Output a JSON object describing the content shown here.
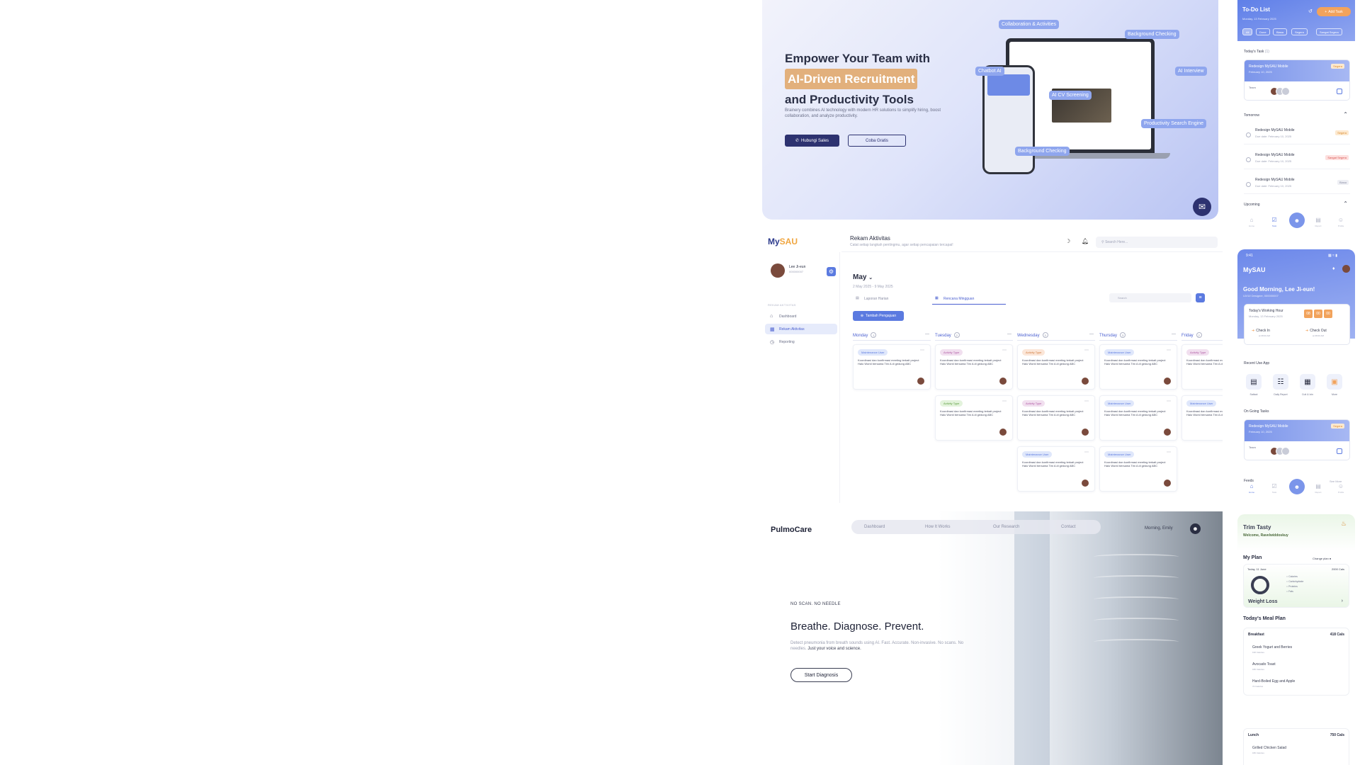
{
  "hero": {
    "title_line1": "Empower Your Team with",
    "title_highlight": "AI-Driven Recruitment",
    "title_line3": "and Productivity Tools",
    "description": "Brainery combines AI technology with modern HR solutions to simplify hiring, boost collaboration, and analyze productivity.",
    "btn_sales": "Hubungi Sales",
    "btn_try": "Coba Gratis",
    "tags": [
      "Collaboration & Activities",
      "Background Checking",
      "Chatbot AI",
      "AI Interview",
      "AI CV Screening",
      "Productivity Search Engine",
      "Background Checking"
    ],
    "chat_icon": "chat-bubble-icon"
  },
  "mysau_web": {
    "logo_a": "My",
    "logo_b": "SAU",
    "page_title": "Rekam Aktivitas",
    "page_subtitle": "Catat setiap langkah pentingmu, agar setiap pencapaian tercapai!",
    "search_placeholder": "Search Here...",
    "profile_name": "Lee Ji-eun",
    "profile_id": "000000007",
    "side_section": "REKAM AKTIVITAS",
    "side_items": [
      "Dashboard",
      "Rekam Aktivitas",
      "Reporting"
    ],
    "month": "May",
    "date_range": "2 May 2025 - 9 May 2025",
    "tabs": [
      "Laporan Harian",
      "Rencana Mingguan"
    ],
    "search2_placeholder": "Search",
    "add_button": "Tambah Pengajuan",
    "columns": [
      {
        "name": "Monday",
        "count": "1"
      },
      {
        "name": "Tuesday",
        "count": "2"
      },
      {
        "name": "Wednesday",
        "count": "3"
      },
      {
        "name": "Thursday",
        "count": "3"
      },
      {
        "name": "Friday",
        "count": "2"
      }
    ],
    "card_text": "Koordinasi dan konfirmasi meeting terkait project Halo World bersama Tim A di gedung ABC",
    "badge_maint": "Maintenance User",
    "badge_act": "Activity Type"
  },
  "pulmo": {
    "brand": "PulmoCare",
    "nav": [
      "Dashboard",
      "How It Works",
      "Our Research",
      "Contact"
    ],
    "greeting": "Morning, Emily",
    "eyebrow": "NO SCAN. NO NEEDLE",
    "headline": "Breathe. Diagnose. Prevent.",
    "desc_a": "Detect pneumonia from breath sounds using AI. Fast. Accurate. Non-invasive. No scans. No needles.",
    "desc_b": "Just your voice and science.",
    "cta": "Start Diagnosis"
  },
  "todo": {
    "title": "To-Do List",
    "date": "Monday, 13 February 2025",
    "add": "Add Task",
    "filters": [
      "All",
      "Done",
      "Biasa",
      "Segera",
      "Sangat Segera"
    ],
    "today_label": "Today's Task",
    "today_count": "(1)",
    "feature": {
      "name": "Redesign MySAU Mobile",
      "date": "February 10, 2025",
      "priority": "Segera",
      "team": "Team"
    },
    "tomorrow_label": "Tomorrow",
    "tomorrow_rows": [
      {
        "name": "Redesign MySAU Mobile",
        "due": "Due date: February 10, 2025",
        "priority": "Segera"
      },
      {
        "name": "Redesign MySAU Mobile",
        "due": "Due date: February 10, 2025",
        "priority": "Sangat Segera"
      },
      {
        "name": "Redesign MySAU Mobile",
        "due": "Due date: February 10, 2025",
        "priority": "Biasa"
      }
    ],
    "upcoming_label": "Upcoming",
    "tabs": [
      "Home",
      "Task",
      "Report",
      "Profile"
    ]
  },
  "home": {
    "time": "9:41",
    "logo": "MySAU",
    "greeting": "Good Morning, Lee Ji-eun!",
    "sub": "UX/UI Designer, 000000007",
    "wh_title": "Today's Working Hour",
    "wh_date": "Monday, 13 February 2025",
    "wh_time": [
      "08",
      "00",
      "00"
    ],
    "check_in": "Check In",
    "check_out": "Check Out",
    "check_time": "at 08:00 AM",
    "recent_label": "Recent Use App",
    "apps": [
      "Sattact",
      "Daily Report",
      "Cuti & Izin",
      "More"
    ],
    "ongoing_label": "On Going Tasks",
    "feature": {
      "name": "Redesign MySAU Mobile",
      "date": "February 10, 2025",
      "priority": "Segera",
      "team": "Team"
    },
    "feeds_label": "Feeds",
    "see_more": "See More",
    "tabs": [
      "Home",
      "Task",
      "Report",
      "Profile"
    ]
  },
  "trim": {
    "title": "Trim Tasty",
    "welcome": "Welcome, Ravelwiddoskuy",
    "plan_label": "My Plan",
    "change_plan": "Change plan",
    "today": "Today, 11 June",
    "calories": "2000 Cals",
    "legend": [
      "Calories",
      "Carbohydrate",
      "Proteins",
      "Fats"
    ],
    "goal": "Weight Loss",
    "meal_label": "Today's Meal Plan",
    "breakfast": {
      "name": "Breakfast",
      "cals": "418 Cals",
      "items": [
        {
          "name": "Greek Yogurt and Berries",
          "cal": "196 Calories"
        },
        {
          "name": "Avocado Toast",
          "cal": "180 Calories"
        },
        {
          "name": "Hard-Boiled Egg and Apple",
          "cal": "72 Calories"
        }
      ]
    },
    "lunch": {
      "name": "Lunch",
      "cals": "750 Cals",
      "items": [
        {
          "name": "Grilled Chicken Salad",
          "cal": "180 Calories"
        }
      ]
    }
  }
}
